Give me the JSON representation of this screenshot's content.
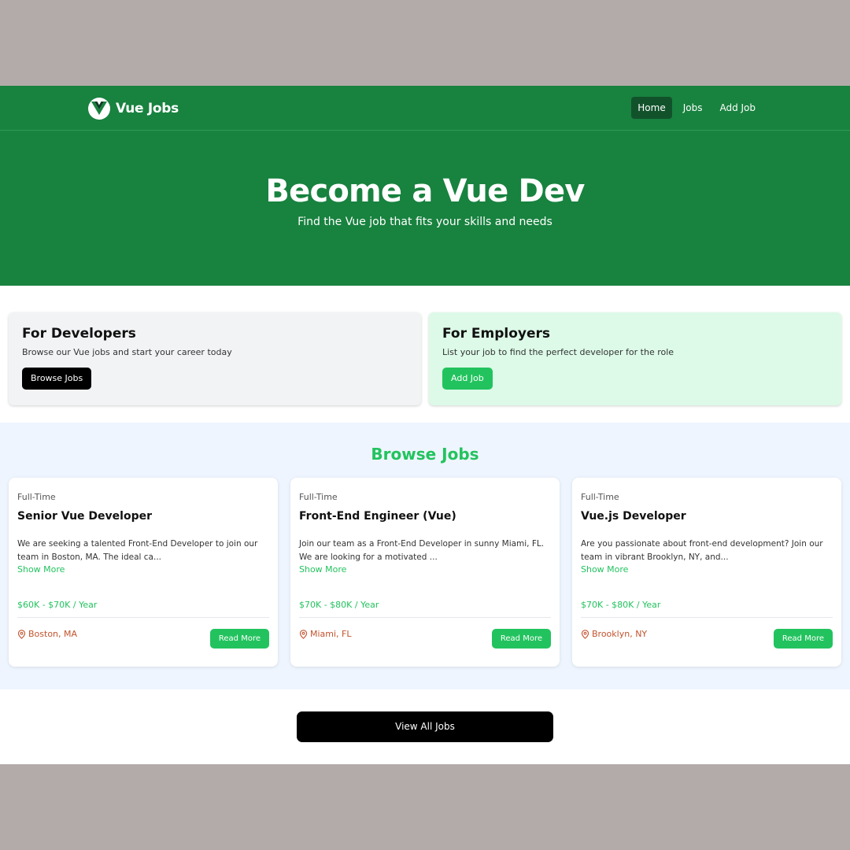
{
  "nav": {
    "brand": "Vue Jobs",
    "links": [
      "Home",
      "Jobs",
      "Add Job"
    ]
  },
  "hero": {
    "title": "Become a Vue Dev",
    "subtitle": "Find the Vue job that fits your skills and needs"
  },
  "cards": {
    "developers": {
      "title": "For Developers",
      "text": "Browse our Vue jobs and start your career today",
      "button": "Browse Jobs"
    },
    "employers": {
      "title": "For Employers",
      "text": "List your job to find the perfect developer for the role",
      "button": "Add Job"
    }
  },
  "jobs": {
    "title": "Browse Jobs",
    "items": [
      {
        "type": "Full-Time",
        "title": "Senior Vue Developer",
        "description": "We are seeking a talented Front-End Developer to join our team in Boston, MA. The ideal ca...",
        "show_more": "Show More",
        "salary": "$60K - $70K / Year",
        "location": "Boston, MA",
        "button": "Read More"
      },
      {
        "type": "Full-Time",
        "title": "Front-End Engineer (Vue)",
        "description": "Join our team as a Front-End Developer in sunny Miami, FL. We are looking for a motivated ...",
        "show_more": "Show More",
        "salary": "$70K - $80K / Year",
        "location": "Miami, FL",
        "button": "Read More"
      },
      {
        "type": "Full-Time",
        "title": "Vue.js Developer",
        "description": "Are you passionate about front-end development? Join our team in vibrant Brooklyn, NY, and...",
        "show_more": "Show More",
        "salary": "$70K - $80K / Year",
        "location": "Brooklyn, NY",
        "button": "Read More"
      }
    ]
  },
  "view_all": "View All Jobs",
  "colors": {
    "primary_green": "#18823f",
    "accent_green": "#22c35e",
    "location_orange": "#c2532d"
  }
}
